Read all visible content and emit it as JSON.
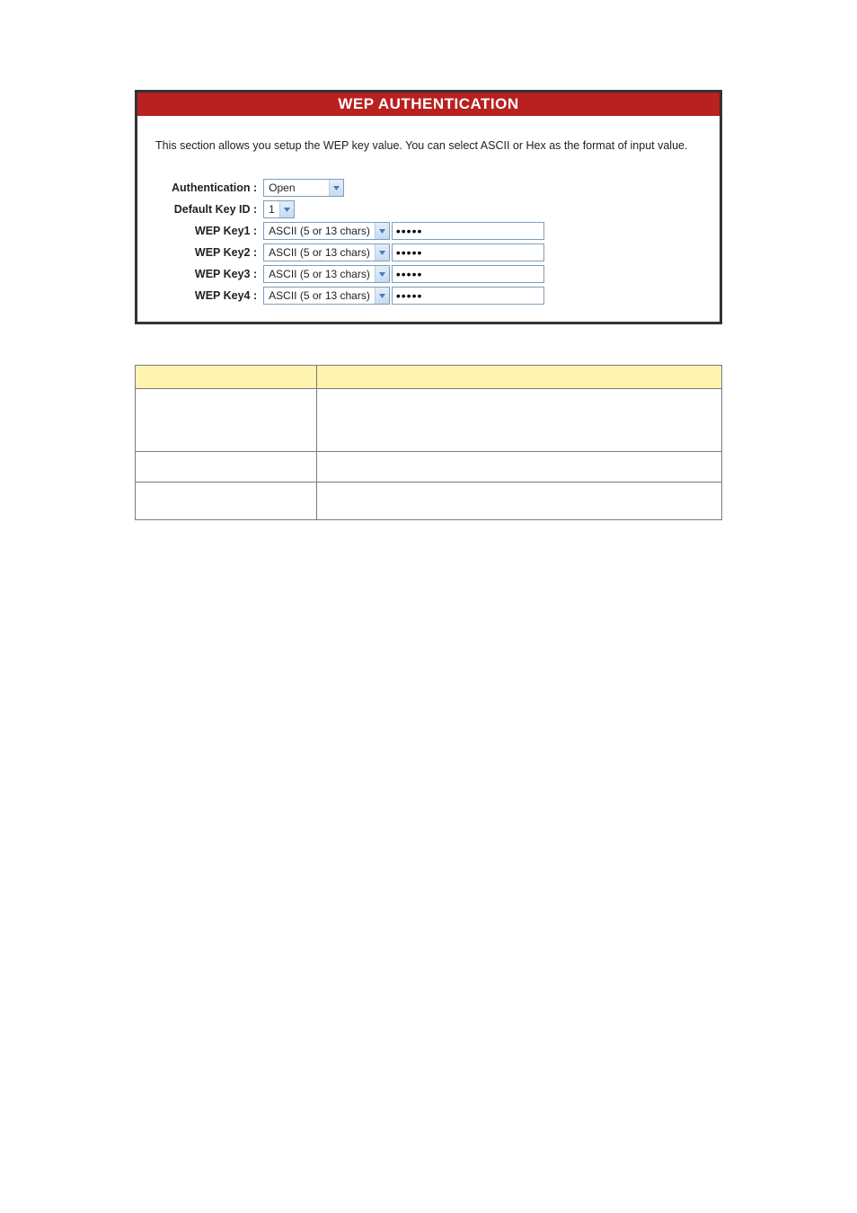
{
  "panel": {
    "title": "WEP AUTHENTICATION",
    "description": "This section allows you setup the WEP key value. You can select ASCII or Hex as the format of input value."
  },
  "form": {
    "labels": {
      "authentication": "Authentication :",
      "default_key_id": "Default Key ID :",
      "wep_key1": "WEP Key1 :",
      "wep_key2": "WEP Key2 :",
      "wep_key3": "WEP Key3 :",
      "wep_key4": "WEP Key4 :"
    },
    "authentication": {
      "value": "Open"
    },
    "default_key_id": {
      "value": "1"
    },
    "wep_keys": [
      {
        "format": "ASCII (5 or 13 chars)",
        "value": "•••••"
      },
      {
        "format": "ASCII (5 or 13 chars)",
        "value": "•••••"
      },
      {
        "format": "ASCII (5 or 13 chars)",
        "value": "•••••"
      },
      {
        "format": "ASCII (5 or 13 chars)",
        "value": "•••••"
      }
    ]
  }
}
